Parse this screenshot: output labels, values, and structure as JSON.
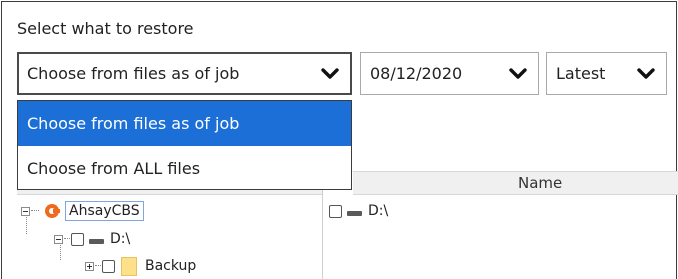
{
  "section_title": "Select what to restore",
  "restore_mode": {
    "selected": "Choose from files as of job",
    "options": [
      "Choose from files as of job",
      "Choose from ALL files"
    ]
  },
  "date_select": {
    "value": "08/12/2020"
  },
  "version_select": {
    "value": "Latest"
  },
  "file_list": {
    "columns": [
      "Name"
    ],
    "rows": [
      {
        "name": "D:\\"
      }
    ]
  },
  "tree": {
    "root": "AhsayCBS",
    "drive": "D:\\",
    "folder": "Backup"
  },
  "colors": {
    "selected_option_bg": "#1b6fd6",
    "brand_logo": "#ef6a1d",
    "folder": "#ffe08a"
  }
}
